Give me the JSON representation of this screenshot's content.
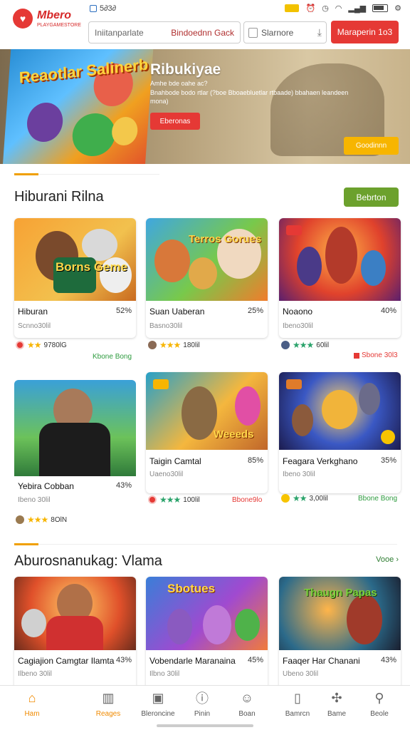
{
  "status": {
    "left_text": "5∂3∂"
  },
  "header": {
    "logo_top": "Mbero",
    "logo_bottom": "PLAYGAMESTORE",
    "search_placeholder": "Iniitanparlate",
    "search_link": "Bindoednn Gack",
    "filter_label": "Slarnore",
    "action_button": "Maraperin 1o3"
  },
  "hero": {
    "art_title": "Reaotlar Salinerb",
    "title": "Ribukiyae",
    "subtitle": "Amhe bde oahe ac?",
    "description": "Bnahbode bodo rtlar (?boe Bboaebluetlar rtbaade) bbahaen leandeen mona)",
    "button_primary": "Eberonas",
    "button_secondary": "Goodinnn"
  },
  "section1": {
    "title": "Hiburani Rilna",
    "button": "Bebrton",
    "cards": [
      {
        "title": "Hiburan",
        "pct": "52%",
        "sub": "Scnno30lil",
        "rating": "9780lG",
        "tag": "Kbone Bong",
        "img_text": "Borns Geme"
      },
      {
        "title": "Suan Uaberan",
        "pct": "25%",
        "sub": "Basno30lil",
        "rating": "180lil",
        "tag": "",
        "img_text": "Terros Gorues"
      },
      {
        "title": "Noaono",
        "pct": "40%",
        "sub": "Ibeno30lil",
        "rating": "60lil",
        "tag": "Sbone 30l3",
        "img_text": ""
      },
      {
        "title": "Yebira Cobban",
        "pct": "43%",
        "sub": "Ibeno 30lil",
        "rating": "8OlN",
        "tag": "",
        "img_text": ""
      },
      {
        "title": "Taigin Camtal",
        "pct": "85%",
        "sub": "Uaeno30lil",
        "rating": "100lil",
        "tag": "Bbone9lo",
        "img_text": "Weeeds"
      },
      {
        "title": "Feagara Verkghano",
        "pct": "35%",
        "sub": "Ibeno 30lil",
        "rating": "3,00lil",
        "tag": "Bbone Bong",
        "img_text": ""
      }
    ]
  },
  "section2": {
    "title": "Aburosnanukag: Vlama",
    "link": "Vooe",
    "cards": [
      {
        "title": "Cagiajion Camgtar Ilamta",
        "pct": "43%",
        "sub": "Ilbeno 30lil",
        "img_text": ""
      },
      {
        "title": "Vobendarle Maranaina",
        "pct": "45%",
        "sub": "Ilbno 30lil",
        "img_text": "Sbotues"
      },
      {
        "title": "Faaqer Har Chanani",
        "pct": "43%",
        "sub": "Ubeno 30lil",
        "img_text": "Thaugn Papas"
      }
    ]
  },
  "nav": [
    {
      "label": "Ham",
      "icon": "home-icon"
    },
    {
      "label": "Reages",
      "icon": "gamepad-icon"
    },
    {
      "label": "Bleroncine",
      "icon": "grid-icon"
    },
    {
      "label": "Pinin",
      "icon": "ticket-icon"
    },
    {
      "label": "Boan",
      "icon": "smile-icon"
    },
    {
      "label": "Bamrcn",
      "icon": "phone-icon"
    },
    {
      "label": "Bame",
      "icon": "puzzle-icon"
    },
    {
      "label": "Beole",
      "icon": "search-icon"
    }
  ],
  "colors": {
    "accent": "#e53935",
    "warning": "#f7b500",
    "green": "#6ca12d",
    "section_line": "#f0a000"
  }
}
